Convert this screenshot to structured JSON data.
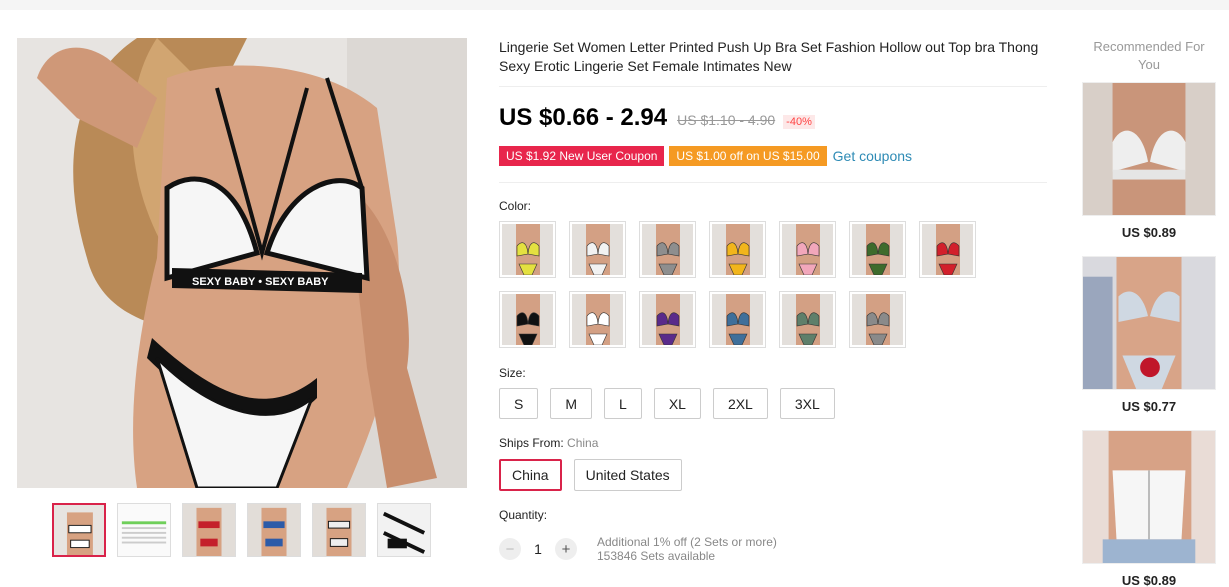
{
  "product": {
    "title": "Lingerie Set Women Letter Printed Push Up Bra Set Fashion Hollow out Top bra Thong Sexy Erotic Lingerie Set Female Intimates New",
    "price": "US $0.66 - 2.94",
    "original_price": "US $1.10 - 4.90",
    "discount": "-40%",
    "coupon_new_user": "US $1.92 New User Coupon",
    "coupon_store": "US $1.00 off on US $15.00",
    "get_coupons": "Get coupons",
    "main_image_print": "SEXY BABY • SEXY BABY"
  },
  "color": {
    "label": "Color:",
    "swatches": [
      {
        "accent": "#e4e040"
      },
      {
        "accent": "#f2f2f2"
      },
      {
        "accent": "#8e8e8e"
      },
      {
        "accent": "#f2b51c"
      },
      {
        "accent": "#f2a7bb"
      },
      {
        "accent": "#3e6b2c"
      },
      {
        "accent": "#d2202b"
      },
      {
        "accent": "#111111"
      },
      {
        "accent": "#ffffff"
      },
      {
        "accent": "#5a2a8a"
      },
      {
        "accent": "#3f6f9a"
      },
      {
        "accent": "#5f7f6a"
      },
      {
        "accent": "#8a8a8a"
      }
    ]
  },
  "size": {
    "label": "Size:",
    "options": [
      "S",
      "M",
      "L",
      "XL",
      "2XL",
      "3XL"
    ]
  },
  "ships": {
    "label": "Ships From:",
    "selected_value": "China",
    "options": [
      "China",
      "United States"
    ]
  },
  "quantity": {
    "label": "Quantity:",
    "value": "1",
    "minus": "−",
    "plus": "+",
    "note_discount": "Additional 1% off (2 Sets or more)",
    "note_available": "153846 Sets available"
  },
  "recommended": {
    "title": "Recommended For You",
    "items": [
      {
        "price": "US $0.89"
      },
      {
        "price": "US $0.77"
      },
      {
        "price": "US $0.89"
      }
    ]
  },
  "colors": {
    "accent_red": "#e8264c",
    "accent_orange": "#f59a23",
    "link_blue": "#2e8bb5",
    "selected_border": "#d9234a"
  }
}
